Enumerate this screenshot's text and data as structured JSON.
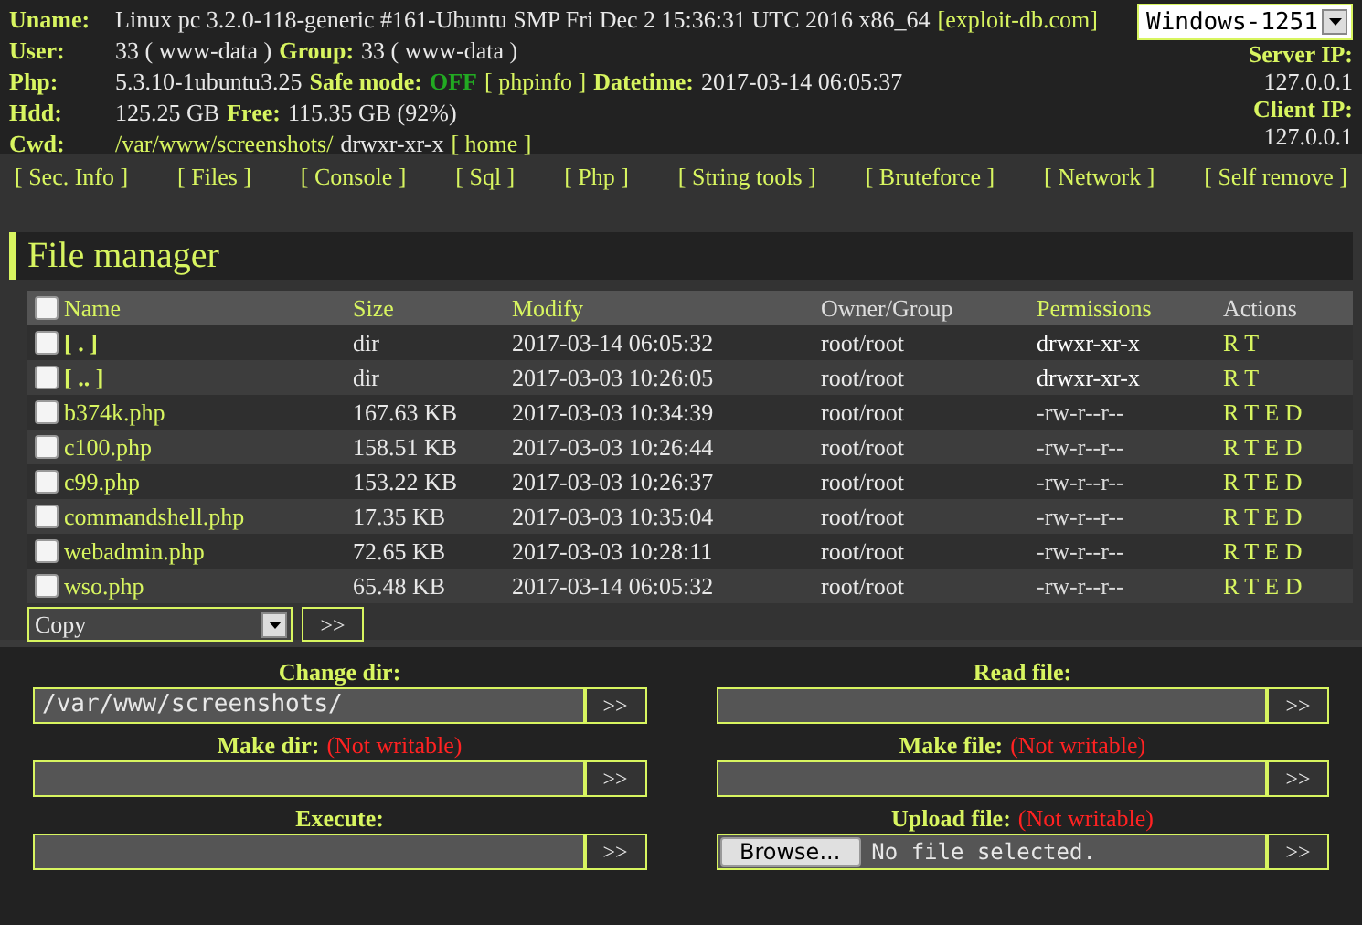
{
  "info": [
    {
      "label": "Uname:",
      "parts": [
        {
          "kind": "text",
          "text": "Linux pc 3.2.0-118-generic #161-Ubuntu SMP Fri Dec 2 15:36:31 UTC 2016 x86_64"
        },
        {
          "kind": "link",
          "text": "[exploit-db.com]"
        }
      ]
    },
    {
      "label": "User:",
      "parts": [
        {
          "kind": "text",
          "text": "33 ( www-data )"
        },
        {
          "kind": "label",
          "text": "Group:"
        },
        {
          "kind": "text",
          "text": "33 ( www-data )"
        }
      ]
    },
    {
      "label": "Php:",
      "parts": [
        {
          "kind": "text",
          "text": "5.3.10-1ubuntu3.25"
        },
        {
          "kind": "label",
          "text": "Safe mode:"
        },
        {
          "kind": "status",
          "text": "OFF"
        },
        {
          "kind": "link",
          "text": "[ phpinfo ]"
        },
        {
          "kind": "label",
          "text": "Datetime:"
        },
        {
          "kind": "text",
          "text": "2017-03-14 06:05:37"
        }
      ]
    },
    {
      "label": "Hdd:",
      "parts": [
        {
          "kind": "text",
          "text": "125.25 GB"
        },
        {
          "kind": "label",
          "text": "Free:"
        },
        {
          "kind": "text",
          "text": "115.35 GB (92%)"
        }
      ]
    },
    {
      "label": "Cwd:",
      "parts": [
        {
          "kind": "link",
          "text": "/var/www/screenshots/"
        },
        {
          "kind": "text",
          "text": "drwxr-xr-x"
        },
        {
          "kind": "link",
          "text": "[ home ]"
        }
      ]
    }
  ],
  "charset": {
    "value": "Windows-1251"
  },
  "ips": [
    {
      "label": "Server IP:",
      "value": "127.0.0.1"
    },
    {
      "label": "Client IP:",
      "value": "127.0.0.1"
    }
  ],
  "nav": [
    "[ Sec. Info ]",
    "[ Files ]",
    "[ Console ]",
    "[ Sql ]",
    "[ Php ]",
    "[ String tools ]",
    "[ Bruteforce ]",
    "[ Network ]",
    "[ Self remove ]"
  ],
  "file_manager": {
    "title": "File manager",
    "select_all": {
      "checked": false
    },
    "columns": [
      {
        "label": "Name",
        "kind": "link"
      },
      {
        "label": "Size",
        "kind": "link"
      },
      {
        "label": "Modify",
        "kind": "link"
      },
      {
        "label": "Owner/Group",
        "kind": "text"
      },
      {
        "label": "Permissions",
        "kind": "link"
      },
      {
        "label": "Actions",
        "kind": "text"
      }
    ],
    "rows": [
      {
        "checked": false,
        "kind": "dir",
        "name": "[ . ]",
        "size": "dir",
        "modify": "2017-03-14 06:05:32",
        "owner": "root/root",
        "permissions": "drwxr-xr-x",
        "actions": "R T"
      },
      {
        "checked": false,
        "kind": "dir",
        "name": "[ .. ]",
        "size": "dir",
        "modify": "2017-03-03 10:26:05",
        "owner": "root/root",
        "permissions": "drwxr-xr-x",
        "actions": "R T"
      },
      {
        "checked": false,
        "kind": "file",
        "name": "b374k.php",
        "size": "167.63 KB",
        "modify": "2017-03-03 10:34:39",
        "owner": "root/root",
        "permissions": "-rw-r--r--",
        "actions": "R T E D"
      },
      {
        "checked": false,
        "kind": "file",
        "name": "c100.php",
        "size": "158.51 KB",
        "modify": "2017-03-03 10:26:44",
        "owner": "root/root",
        "permissions": "-rw-r--r--",
        "actions": "R T E D"
      },
      {
        "checked": false,
        "kind": "file",
        "name": "c99.php",
        "size": "153.22 KB",
        "modify": "2017-03-03 10:26:37",
        "owner": "root/root",
        "permissions": "-rw-r--r--",
        "actions": "R T E D"
      },
      {
        "checked": false,
        "kind": "file",
        "name": "commandshell.php",
        "size": "17.35 KB",
        "modify": "2017-03-03 10:35:04",
        "owner": "root/root",
        "permissions": "-rw-r--r--",
        "actions": "R T E D"
      },
      {
        "checked": false,
        "kind": "file",
        "name": "webadmin.php",
        "size": "72.65 KB",
        "modify": "2017-03-03 10:28:11",
        "owner": "root/root",
        "permissions": "-rw-r--r--",
        "actions": "R T E D"
      },
      {
        "checked": false,
        "kind": "file",
        "name": "wso.php",
        "size": "65.48 KB",
        "modify": "2017-03-14 06:05:32",
        "owner": "root/root",
        "permissions": "-rw-r--r--",
        "actions": "R T E D"
      }
    ],
    "bulk": {
      "value": "Copy",
      "button": ">>"
    }
  },
  "forms": [
    {
      "kind": "text",
      "label": "Change dir:",
      "value": "/var/www/screenshots/",
      "button": ">>"
    },
    {
      "kind": "text",
      "label": "Read file:",
      "button": ">>"
    },
    {
      "kind": "text",
      "label": "Make dir:",
      "note": "(Not writable)",
      "button": ">>"
    },
    {
      "kind": "text",
      "label": "Make file:",
      "note": "(Not writable)",
      "button": ">>"
    },
    {
      "kind": "text",
      "label": "Execute:",
      "button": ">>"
    },
    {
      "kind": "file",
      "label": "Upload file:",
      "note": "(Not writable)",
      "browse": "Browse...",
      "file_status": "No file selected.",
      "button": ">>"
    }
  ]
}
